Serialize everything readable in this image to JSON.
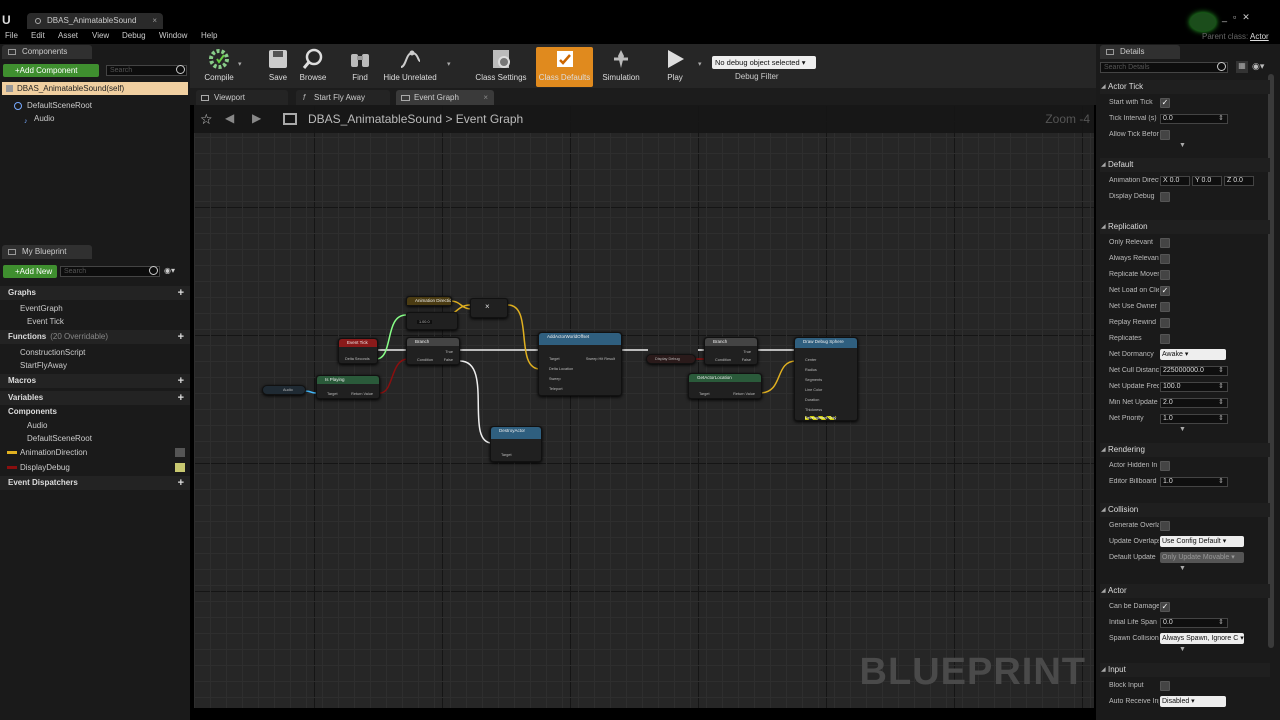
{
  "tab": {
    "title": "DBAS_AnimatableSound"
  },
  "parent_class": {
    "label": "Parent class:",
    "value": "Actor"
  },
  "menu": [
    "File",
    "Edit",
    "Asset",
    "View",
    "Debug",
    "Window",
    "Help"
  ],
  "components_panel": {
    "tab": "Components",
    "add_button": "+Add Component",
    "search_placeholder": "Search",
    "self_item": "DBAS_AnimatableSound(self)",
    "tree": [
      "DefaultSceneRoot",
      "Audio"
    ]
  },
  "my_blueprint": {
    "tab": "My Blueprint",
    "add_button": "+Add New",
    "search_placeholder": "Search",
    "sections": {
      "graphs": "Graphs",
      "functions": "Functions",
      "functions_note": "(20 Overridable)",
      "macros": "Macros",
      "variables": "Variables",
      "components": "Components",
      "dispatchers": "Event Dispatchers"
    },
    "graph_items": [
      "EventGraph",
      "Event Tick"
    ],
    "function_items": [
      "ConstructionScript",
      "StartFlyAway"
    ],
    "component_items": [
      "Audio",
      "DefaultSceneRoot"
    ],
    "variable_items": [
      {
        "name": "AnimationDirection",
        "color": "#e0b020"
      },
      {
        "name": "DisplayDebug",
        "color": "#8a0f0f"
      }
    ]
  },
  "toolbar": {
    "compile": "Compile",
    "save": "Save",
    "browse": "Browse",
    "find": "Find",
    "hide_unrelated": "Hide Unrelated",
    "class_settings": "Class Settings",
    "class_defaults": "Class Defaults",
    "simulation": "Simulation",
    "play": "Play",
    "debug_select": "No debug object selected",
    "debug_filter": "Debug Filter"
  },
  "graph_tabs": [
    "Viewport",
    "Start Fly Away",
    "Event Graph"
  ],
  "breadcrumb": {
    "root": "DBAS_AnimatableSound",
    "sep": ">",
    "current": "Event Graph"
  },
  "zoom": "Zoom -4",
  "watermark": "BLUEPRINT",
  "nodes": {
    "event_tick": {
      "title": "Event Tick",
      "pin": "Delta Seconds"
    },
    "anim_dir": {
      "title": "Animation Direction"
    },
    "multiply": {
      "title": "×"
    },
    "vec": {
      "value": "1.00.0"
    },
    "branch1": {
      "title": "Branch",
      "pins": [
        "Condition",
        "True",
        "False"
      ]
    },
    "is_playing": {
      "title": "Is Playing",
      "sub": "Target is Audio Component",
      "pins": [
        "Target",
        "Return Value"
      ]
    },
    "audio": {
      "title": "Audio"
    },
    "add_offset": {
      "title": "AddActorWorldOffset",
      "sub": "Target is Actor",
      "pins": [
        "Target",
        "Delta Location",
        "Sweep",
        "Teleport",
        "Sweep Hit Result"
      ]
    },
    "destroy": {
      "title": "DestroyActor",
      "sub": "Target is Actor",
      "pins": [
        "Target"
      ]
    },
    "display_debug": {
      "title": "Display Debug"
    },
    "branch2": {
      "title": "Branch",
      "pins": [
        "Condition",
        "True",
        "False"
      ]
    },
    "get_loc": {
      "title": "GetActorLocation",
      "sub": "Target is Actor",
      "pins": [
        "Target",
        "Return Value"
      ]
    },
    "draw_sphere": {
      "title": "Draw Debug Sphere",
      "pins": [
        "Center",
        "Radius",
        "Segments",
        "Line Color",
        "Duration",
        "Thickness",
        "Development Only"
      ]
    }
  },
  "details": {
    "tab": "Details",
    "search_placeholder": "Search Details",
    "sections": {
      "actor_tick": "Actor Tick",
      "default": "Default",
      "replication": "Replication",
      "rendering": "Rendering",
      "collision": "Collision",
      "actor": "Actor",
      "input": "Input"
    },
    "actor_tick": [
      {
        "label": "Start with Tick",
        "type": "check",
        "value": "✓"
      },
      {
        "label": "Tick Interval (s)",
        "type": "num",
        "value": "0.0"
      },
      {
        "label": "Allow Tick Before",
        "type": "check",
        "value": ""
      }
    ],
    "default": [
      {
        "label": "Animation Direction",
        "type": "vec",
        "x": "X 0.0",
        "y": "Y 0.0",
        "z": "Z 0.0"
      },
      {
        "label": "Display Debug",
        "type": "check",
        "value": ""
      }
    ],
    "replication": [
      {
        "label": "Only Relevant",
        "type": "check",
        "value": ""
      },
      {
        "label": "Always Relevant",
        "type": "check",
        "value": ""
      },
      {
        "label": "Replicate Movement",
        "type": "check",
        "value": ""
      },
      {
        "label": "Net Load on Client",
        "type": "check",
        "value": "✓"
      },
      {
        "label": "Net Use Owner",
        "type": "check",
        "value": ""
      },
      {
        "label": "Replay Rewind",
        "type": "check",
        "value": ""
      },
      {
        "label": "Replicates",
        "type": "check",
        "value": ""
      },
      {
        "label": "Net Dormancy",
        "type": "dd",
        "value": "Awake"
      },
      {
        "label": "Net Cull Distance",
        "type": "num",
        "value": "225000000.0"
      },
      {
        "label": "Net Update Freq",
        "type": "num",
        "value": "100.0"
      },
      {
        "label": "Min Net Update",
        "type": "num",
        "value": "2.0"
      },
      {
        "label": "Net Priority",
        "type": "num",
        "value": "1.0"
      }
    ],
    "rendering": [
      {
        "label": "Actor Hidden In Game",
        "type": "check",
        "value": ""
      },
      {
        "label": "Editor Billboard",
        "type": "num",
        "value": "1.0"
      }
    ],
    "collision": [
      {
        "label": "Generate Overlap",
        "type": "check",
        "value": ""
      },
      {
        "label": "Update Overlaps",
        "type": "dd",
        "value": "Use Config Default"
      },
      {
        "label": "Default Update",
        "type": "dd",
        "value": "Only Update Movable",
        "disabled": true
      }
    ],
    "actor": [
      {
        "label": "Can be Damaged",
        "type": "check",
        "value": "✓"
      },
      {
        "label": "Initial Life Span",
        "type": "num",
        "value": "0.0"
      },
      {
        "label": "Spawn Collision",
        "type": "dd",
        "value": "Always Spawn, Ignore C"
      }
    ],
    "input": [
      {
        "label": "Block Input",
        "type": "check",
        "value": ""
      },
      {
        "label": "Auto Receive Input",
        "type": "dd",
        "value": "Disabled"
      }
    ]
  }
}
